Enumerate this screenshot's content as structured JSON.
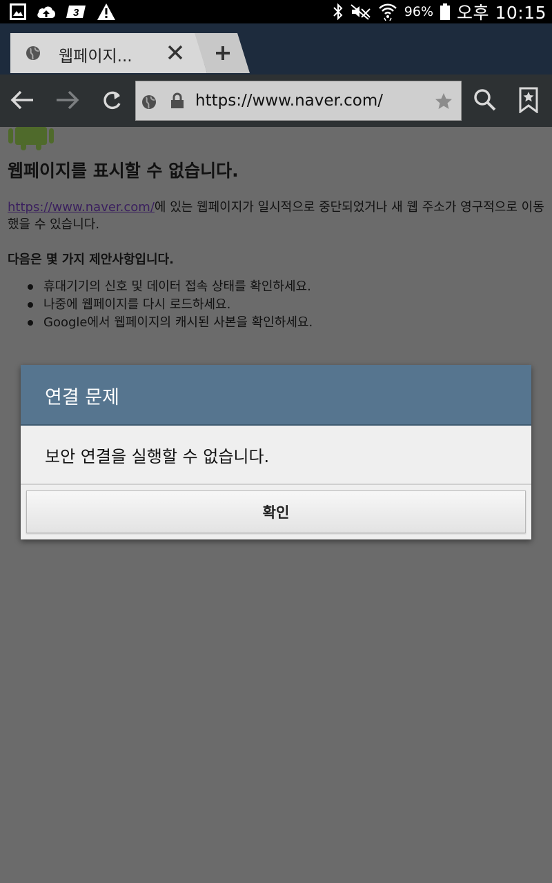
{
  "status_bar": {
    "battery_percent": "96%",
    "clock": "오후 10:15",
    "left_icons": [
      "gallery-icon",
      "cloud-upload-icon",
      "3g-icon",
      "warning-icon"
    ],
    "right_icons": [
      "bluetooth-icon",
      "mute-icon",
      "wifi-icon",
      "battery-icon"
    ]
  },
  "tabs": [
    {
      "title": "웹페이지...",
      "active": true
    }
  ],
  "toolbar": {
    "url": "https://www.naver.com/"
  },
  "page": {
    "headline": "웹페이지를 표시할 수 없습니다.",
    "link_text": "https://www.naver.com/",
    "desc_rest": "에 있는 웹페이지가 일시적으로 중단되었거나 새 웹 주소가 영구적으로 이동했을 수 있습니다.",
    "suggestions_title": "다음은 몇 가지 제안사항입니다.",
    "suggestions": [
      "휴대기기의 신호 및 데이터 접속 상태를 확인하세요.",
      "나중에 웹페이지를 다시 로드하세요.",
      "Google에서 웹페이지의 캐시된 사본을 확인하세요."
    ]
  },
  "dialog": {
    "title": "연결 문제",
    "message": "보안 연결을 실행할 수 없습니다.",
    "ok_label": "확인"
  },
  "colors": {
    "dialog_header": "#56758f",
    "overlay": "#6b6b6b",
    "tab_bar": "#1d2b3d",
    "toolbar": "#2d3133"
  }
}
